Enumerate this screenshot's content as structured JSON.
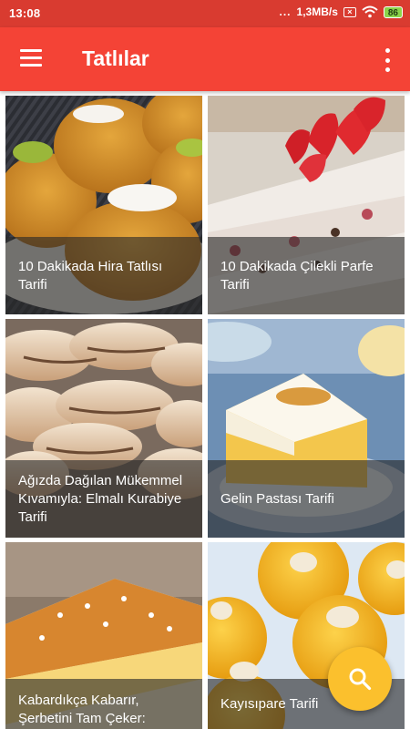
{
  "status_bar": {
    "time": "13:08",
    "signal_dots": "...",
    "network_speed": "1,3MB/s",
    "sim_icon": "no-sim-icon",
    "wifi_icon": "wifi-icon",
    "battery_level": "86"
  },
  "app_bar": {
    "title": "Tatlılar",
    "menu_icon": "hamburger-menu-icon",
    "more_icon": "more-vertical-icon",
    "background_color": "#f44336"
  },
  "recipes": [
    {
      "title": "10 Dakikada Hira Tatlısı Tarifi"
    },
    {
      "title": "10 Dakikada Çilekli Parfe Tarifi"
    },
    {
      "title": "Ağızda Dağılan Mükemmel Kıvamıyla: Elmalı Kurabiye Tarifi"
    },
    {
      "title": "Gelin Pastası Tarifi"
    },
    {
      "title": "Kabardıkça Kabarır, Şerbetini Tam Çeker:"
    },
    {
      "title": "Kayısıpare Tarifi"
    }
  ],
  "fab": {
    "icon": "search-icon",
    "color": "#fbc02d"
  }
}
